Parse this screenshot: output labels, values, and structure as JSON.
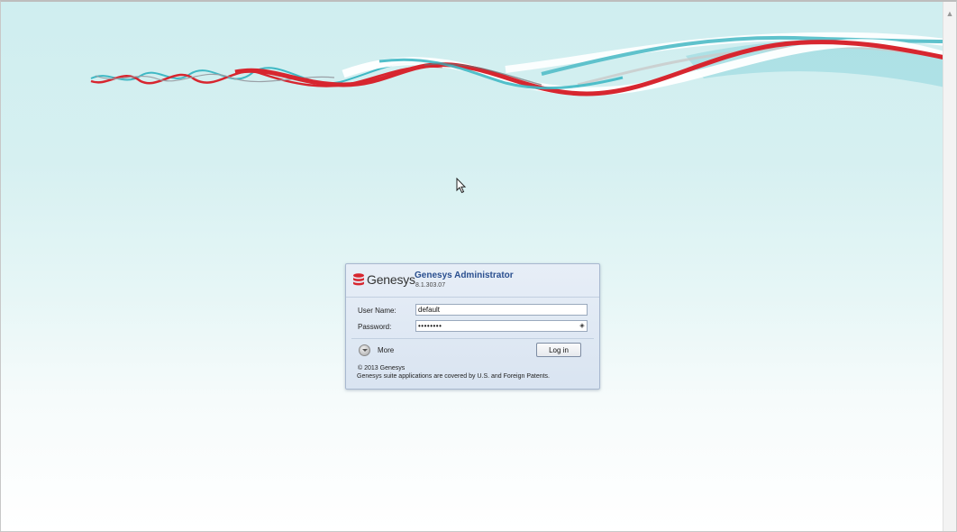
{
  "login": {
    "brand_name": "Genesys",
    "app_title": "Genesys Administrator",
    "version": "8.1.303.07",
    "username_label": "User Name:",
    "username_value": "default",
    "password_label": "Password:",
    "password_value": "********",
    "more_label": "More",
    "login_button": "Log in",
    "copyright": "© 2013 Genesys",
    "patent_notice": "Genesys suite applications are covered by U.S. and Foreign Patents."
  },
  "icons": {
    "brand_logo": "genesys-logo-icon",
    "password_reveal": "reveal-password-icon",
    "more": "expand-more-icon",
    "cursor": "mouse-pointer-icon",
    "scroll_up": "scroll-up-arrow-icon"
  },
  "colors": {
    "brand_red": "#d7262f",
    "title_blue": "#2a4f8f",
    "ribbon_teal": "#3fb8c4",
    "background_top": "#cfeef0"
  }
}
